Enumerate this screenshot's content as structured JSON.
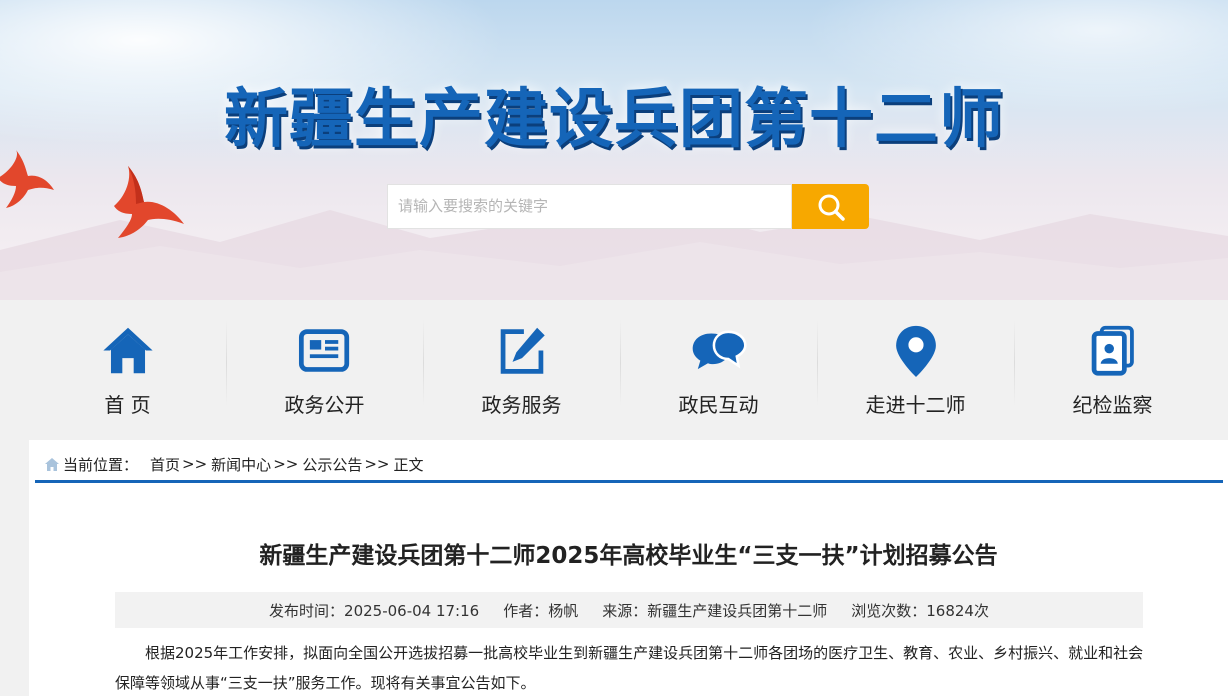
{
  "header": {
    "site_title": "新疆生产建设兵团第十二师"
  },
  "search": {
    "placeholder": "请输入要搜索的关键字",
    "button_icon": "search-icon",
    "button_color": "#f7a800"
  },
  "nav": {
    "items": [
      {
        "label": "首 页",
        "icon": "home-icon"
      },
      {
        "label": "政务公开",
        "icon": "newspaper-icon"
      },
      {
        "label": "政务服务",
        "icon": "edit-icon"
      },
      {
        "label": "政民互动",
        "icon": "chat-bubbles-icon"
      },
      {
        "label": "走进十二师",
        "icon": "map-pin-icon"
      },
      {
        "label": "纪检监察",
        "icon": "id-card-icon"
      }
    ],
    "icon_color": "#1565b8"
  },
  "breadcrumb": {
    "label": "当前位置：",
    "items": [
      "首页",
      "新闻中心",
      "公示公告",
      "正文"
    ],
    "separator": ">>"
  },
  "article": {
    "title": "新疆生产建设兵团第十二师2025年高校毕业生“三支一扶”计划招募公告",
    "meta": {
      "publish_time": "发布时间：2025-06-04 17:16",
      "author": "作者：杨帆",
      "source": "来源：新疆生产建设兵团第十二师",
      "views": "浏览次数：16824次"
    },
    "body": "根据2025年工作安排，拟面向全国公开选拔招募一批高校毕业生到新疆生产建设兵团第十二师各团场的医疗卫生、教育、农业、乡村振兴、就业和社会保障等领域从事“三支一扶”服务工作。现将有关事宜公告如下。"
  },
  "colors": {
    "brand_blue": "#1565b8",
    "accent_orange": "#f7a800"
  }
}
